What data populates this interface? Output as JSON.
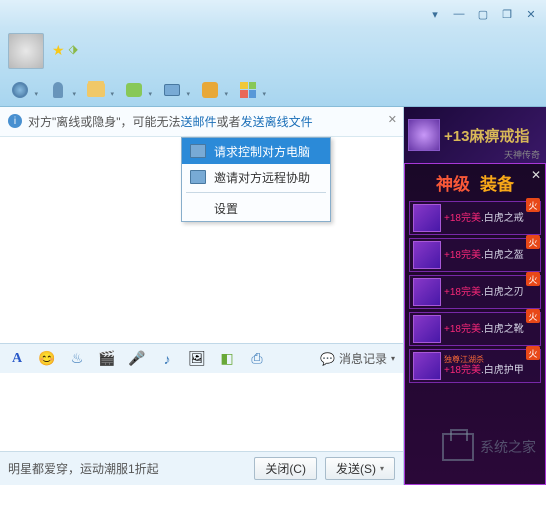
{
  "titlebar": {
    "min": "—",
    "max": "▢",
    "restore": "❐",
    "close": "✕",
    "down": "▾"
  },
  "toolbar": {
    "icons": [
      "camera",
      "mic",
      "folder",
      "chat",
      "screen",
      "app",
      "grid"
    ]
  },
  "notice": {
    "prefix": "对方\"离线或隐身\"，可能无法",
    "mid_link": "送邮件",
    "mid_text": "或者",
    "link2": "发送离线文件"
  },
  "dropdown": {
    "items": [
      {
        "label": "请求控制对方电脑",
        "icon": true
      },
      {
        "label": "邀请对方远程协助",
        "icon": true
      },
      {
        "label": "设置",
        "icon": false
      }
    ]
  },
  "fmtbar": {
    "font": "A",
    "history_label": "消息记录"
  },
  "bottombar": {
    "promo": "明星都爱穿，运动潮服1折起",
    "close_btn": "关闭(C)",
    "send_btn": "发送(S)"
  },
  "ad_top": {
    "text": "+13麻痹戒指",
    "sub": "天神传奇"
  },
  "ad_panel": {
    "title1": "神级",
    "title2": "装备",
    "items": [
      {
        "l1": "+18完美",
        "l2": ".白虎之戒",
        "fire": "火"
      },
      {
        "l1": "+18完美",
        "l2": ".白虎之盔",
        "fire": "火"
      },
      {
        "l1": "+18完美",
        "l2": ".白虎之刃",
        "fire": "火"
      },
      {
        "l1": "+18完美",
        "l2": ".白虎之靴",
        "fire": "火"
      },
      {
        "l1": "+18完美",
        "l2": ".白虎护甲",
        "fire": "火",
        "pre": "独尊江湖杀"
      }
    ]
  },
  "watermark": "系统之家"
}
